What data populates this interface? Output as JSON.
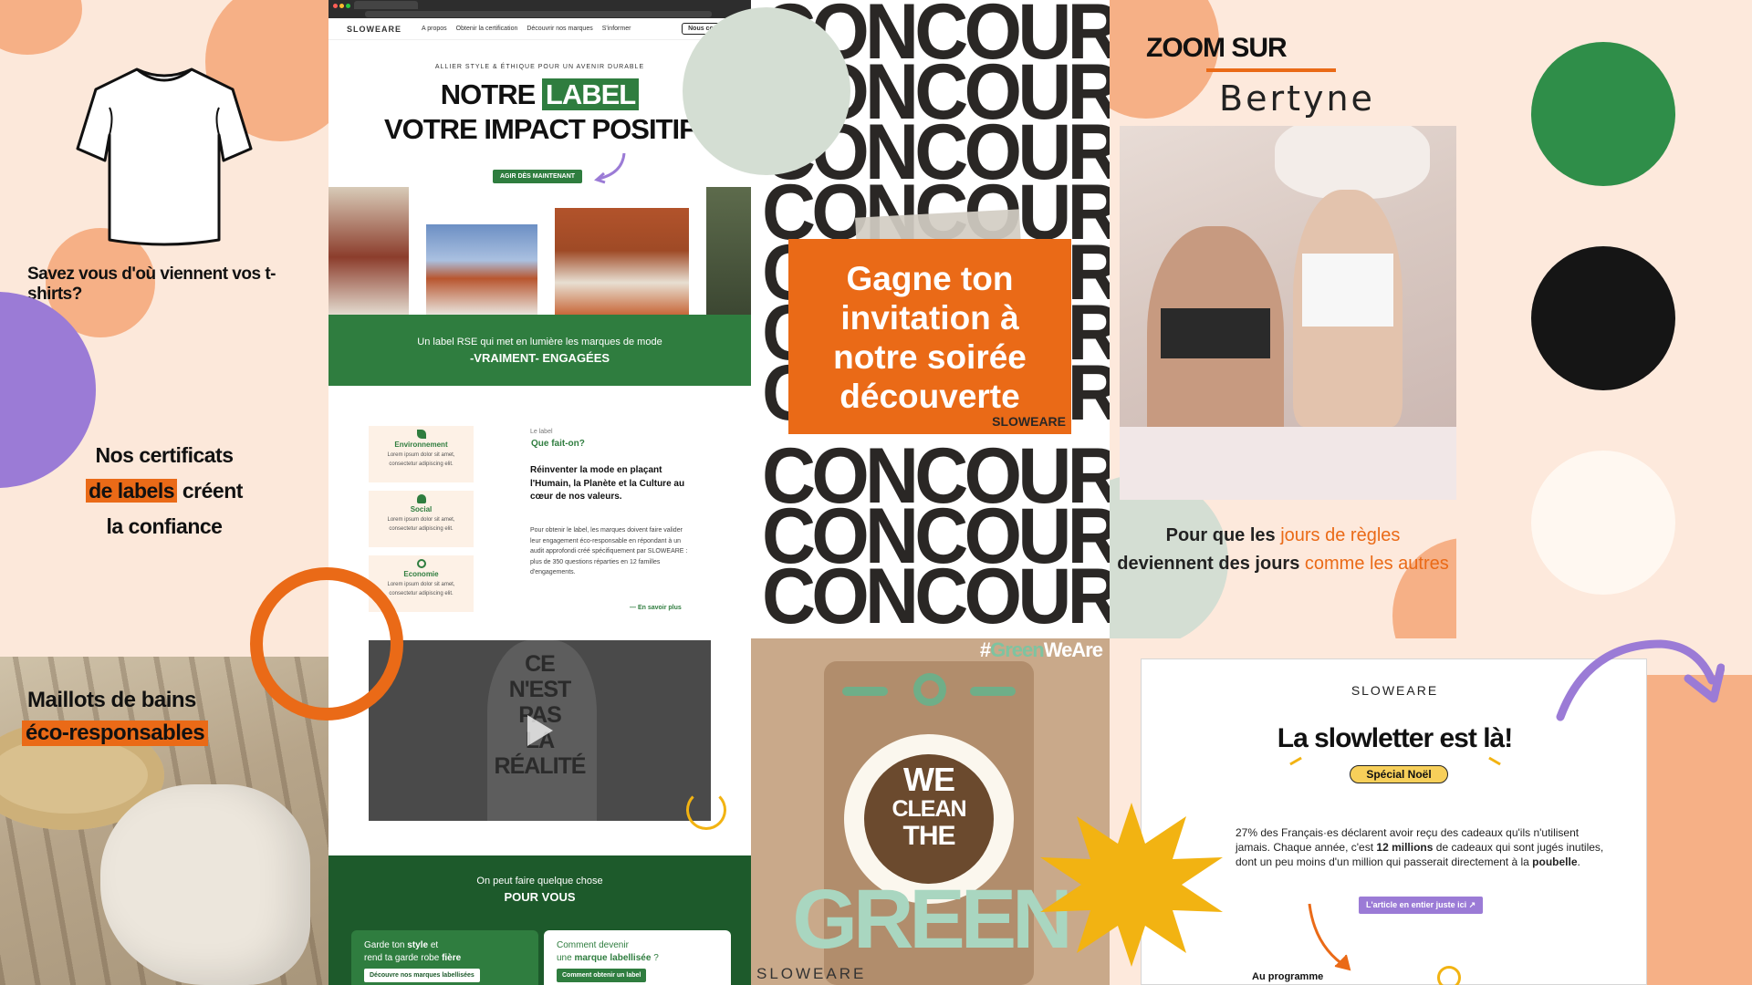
{
  "tshirt_card": {
    "question": "Savez vous d'où viennent vos t-shirts?"
  },
  "certificates": {
    "line1": "Nos certificats",
    "highlight": "de labels",
    "line2_rest": "créent",
    "line3": "la confiance"
  },
  "swimwear": {
    "line1": "Maillots de bains",
    "line2": "éco-responsables"
  },
  "website": {
    "logo": "SLOWEARE",
    "nav": [
      "A propos",
      "Obtenir la certification",
      "Découvrir nos marques",
      "S'informer"
    ],
    "nav_button": "Nous con",
    "kicker": "ALLIER STYLE & ÉTHIQUE POUR UN AVENIR DURABLE",
    "title_part1": "NOTRE",
    "title_highlight": "LABEL",
    "title_line2": "VOTRE IMPACT POSITIF",
    "cta": "AGIR DÈS MAINTENANT",
    "green_band_line1": "Un label RSE qui met en lumière les marques de mode",
    "green_band_line2": "-VRAIMENT- ENGAGÉES",
    "pillars": [
      {
        "title": "Environnement",
        "text": "Lorem ipsum dolor sit amet, consectetur adipiscing elit."
      },
      {
        "title": "Social",
        "text": "Lorem ipsum dolor sit amet, consectetur adipiscing elit."
      },
      {
        "title": "Economie",
        "text": "Lorem ipsum dolor sit amet, consectetur adipiscing elit."
      }
    ],
    "label_kicker": "Le label",
    "label_title": "Que fait-on?",
    "label_lead": "Réinventer la mode en plaçant l'Humain, la Planète et la Culture au cœur de nos valeurs.",
    "label_body": "Pour obtenir le label, les marques doivent faire valider leur engagement éco-responsable en répondant à un audit approfondi créé spécifiquement par SLOWEARE : plus de 350 questions réparties en 12 familles d'engagements.",
    "label_more": "— En savoir plus",
    "video_text": [
      "CE",
      "N'EST",
      "PAS",
      "LA",
      "RÉALITÉ"
    ],
    "bottom_line1": "On peut faire quelque chose",
    "bottom_line2": "POUR VOUS",
    "card1_text_a": "Garde ton",
    "card1_bold_a": "style",
    "card1_text_b": "et",
    "card1_text_c": "rend ta garde robe",
    "card1_bold_b": "fière",
    "card1_button": "Découvre nos marques labellisées",
    "card2_line1": "Comment devenir",
    "card2_text": "une",
    "card2_bold": "marque labellisée",
    "card2_end": "?",
    "card2_button": "Comment obtenir un label"
  },
  "concours": {
    "word": "CONCOURS",
    "headline": [
      "Gagne ton",
      "invitation à",
      "notre soirée",
      "découverte"
    ],
    "brand": "SLOWEARE"
  },
  "washer": {
    "hashtag_a": "#",
    "hashtag_green": "Green",
    "hashtag_b": "WeAre",
    "line1": "WE",
    "line2": "CLEAN",
    "line3": "THE",
    "line4": "GREEN",
    "brand": "SLOWEARE"
  },
  "zoom": {
    "title": "ZOOM SUR",
    "brand": "Bertyne",
    "caption_a": "Pour que les",
    "caption_b": "jours de règles",
    "caption_c": "deviennent des jours",
    "caption_d": "comme les autres"
  },
  "letter": {
    "brand": "SLOWEARE",
    "title": "La slowletter est là!",
    "badge": "Spécial Noël",
    "body_a": "27% des Français·es déclarent avoir reçu des cadeaux qu'ils n'utilisent jamais. Chaque année, c'est",
    "body_bold1": "12 millions",
    "body_b": "de cadeaux qui sont jugés inutiles, dont un peu moins d'un million qui passerait directement à la",
    "body_bold2": "poubelle",
    "body_end": ".",
    "button": "L'article en entier juste ici ↗",
    "program": "Au programme"
  },
  "colors": {
    "green": "#2f7d3f",
    "dark_green": "#1d5a2b",
    "orange": "#ea6a17",
    "purple": "#9b7bd6",
    "peach": "#f7b38a",
    "dark": "#2a2725",
    "yellow": "#f2b312"
  }
}
